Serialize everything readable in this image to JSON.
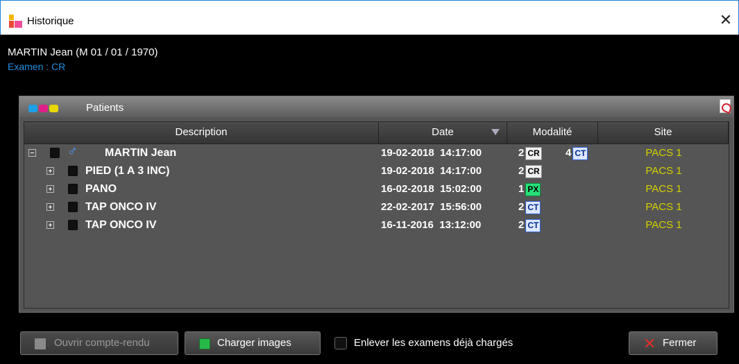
{
  "window": {
    "title": "Historique",
    "close_glyph": "✕"
  },
  "patient": {
    "header": "MARTIN Jean (M 01 / 01 / 1970)",
    "exam": "Examen : CR"
  },
  "panel": {
    "title": "Patients",
    "dot_colors": [
      "#1ea0e8",
      "#e0208a",
      "#e8d800"
    ]
  },
  "table": {
    "columns": [
      "Description",
      "Date",
      "Modalité",
      "Site"
    ],
    "sorted_column": "Date",
    "rows": [
      {
        "level": 0,
        "expanded": true,
        "icon": "male-icon",
        "description": "MARTIN Jean",
        "date": "19-02-2018  14:17:00",
        "modalities": [
          {
            "count": "2",
            "code": "CR"
          },
          {
            "count": "4",
            "code": "CT"
          }
        ],
        "site": "PACS 1"
      },
      {
        "level": 1,
        "expanded": false,
        "description": "PIED (1 A 3 INC)",
        "date": "19-02-2018  14:17:00",
        "modalities": [
          {
            "count": "2",
            "code": "CR"
          }
        ],
        "site": "PACS 1"
      },
      {
        "level": 1,
        "expanded": false,
        "description": "PANO",
        "date": "16-02-2018  15:02:00",
        "modalities": [
          {
            "count": "1",
            "code": "PX"
          }
        ],
        "site": "PACS 1"
      },
      {
        "level": 1,
        "expanded": false,
        "description": "TAP ONCO IV",
        "date": "22-02-2017  15:56:00",
        "modalities": [
          {
            "count": "2",
            "code": "CT"
          }
        ],
        "site": "PACS 1"
      },
      {
        "level": 1,
        "expanded": false,
        "description": "TAP ONCO IV",
        "date": "16-11-2016  13:12:00",
        "modalities": [
          {
            "count": "2",
            "code": "CT"
          }
        ],
        "site": "PACS 1"
      }
    ]
  },
  "footer": {
    "open_report": "Ouvrir compte-rendu",
    "load_images": "Charger images",
    "remove_loaded": "Enlever les examens déjà chargés",
    "close": "Fermer"
  }
}
